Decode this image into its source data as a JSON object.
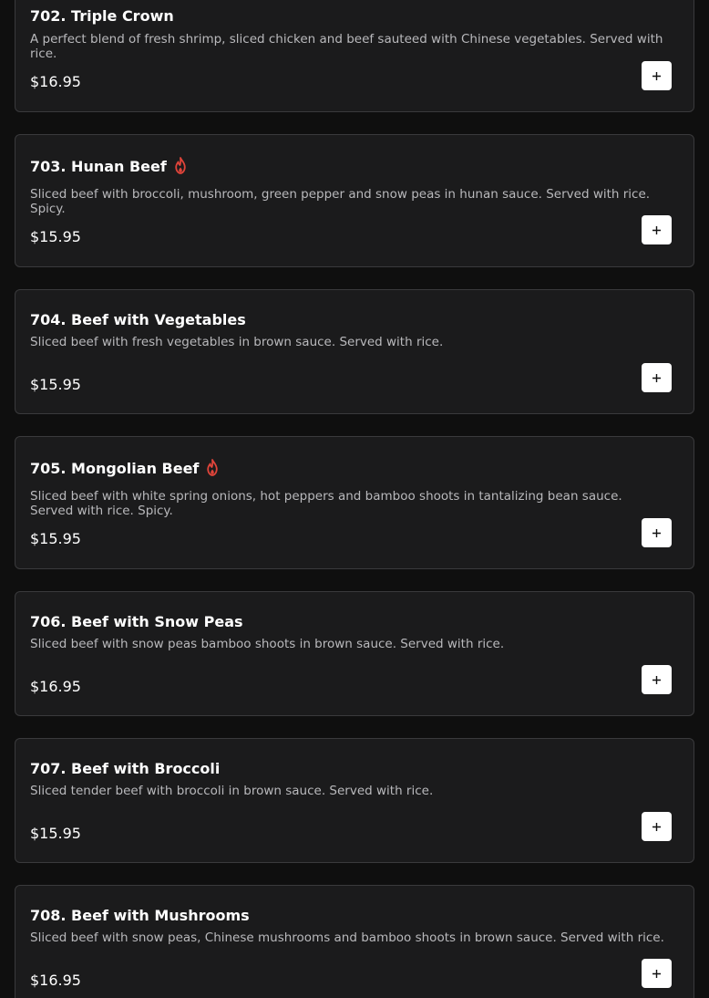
{
  "menu": {
    "currency": "$",
    "items": [
      {
        "title": "702. Triple Crown",
        "spicy": false,
        "description": "A perfect blend of fresh shrimp, sliced chicken and beef sauteed with Chinese vegetables. Served with rice.",
        "price": "$16.95"
      },
      {
        "title": "703. Hunan Beef",
        "spicy": true,
        "description": "Sliced beef with broccoli, mushroom, green pepper and snow peas in hunan sauce. Served with rice. Spicy.",
        "price": "$15.95"
      },
      {
        "title": "704. Beef with Vegetables",
        "spicy": false,
        "description": "Sliced beef with fresh vegetables in brown sauce. Served with rice.",
        "price": "$15.95"
      },
      {
        "title": "705. Mongolian Beef",
        "spicy": true,
        "description": "Sliced beef with white spring onions, hot peppers and bamboo shoots in tantalizing bean sauce. Served with rice. Spicy.",
        "price": "$15.95"
      },
      {
        "title": "706. Beef with Snow Peas",
        "spicy": false,
        "description": "Sliced beef with snow peas bamboo shoots in brown sauce. Served with rice.",
        "price": "$16.95"
      },
      {
        "title": "707. Beef with Broccoli",
        "spicy": false,
        "description": "Sliced tender beef with broccoli in brown sauce. Served with rice.",
        "price": "$15.95"
      },
      {
        "title": "708. Beef with Mushrooms",
        "spicy": false,
        "description": "Sliced beef with snow peas, Chinese mushrooms and bamboo shoots in brown sauce. Served with rice.",
        "price": "$16.95"
      }
    ]
  },
  "icons": {
    "spicy": "flame-icon",
    "add": "plus-icon"
  },
  "colors": {
    "background": "#0f0f0f",
    "card": "#1b1b1c",
    "card_border": "#3a3a3c",
    "spicy_accent": "#e0443a",
    "button": "#ffffff"
  }
}
